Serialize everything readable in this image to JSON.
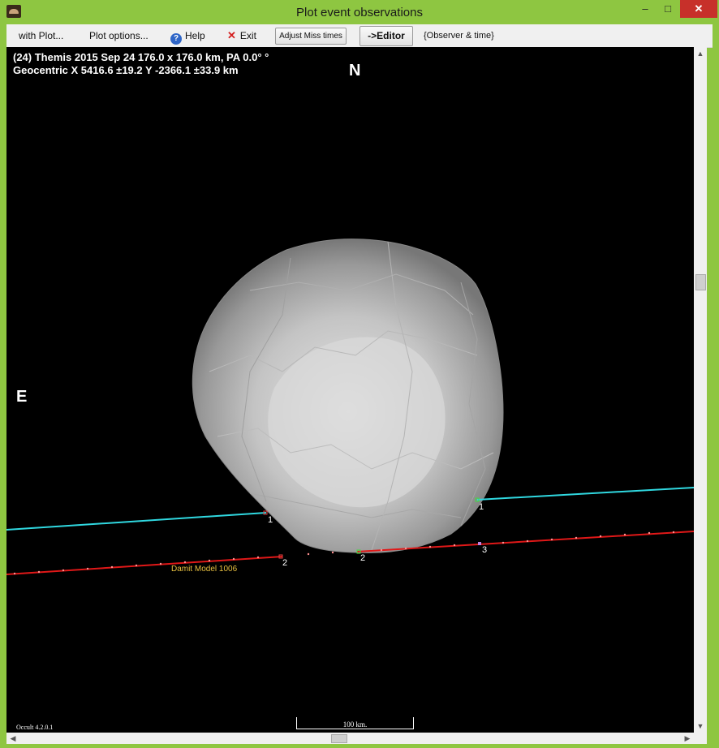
{
  "window": {
    "title": "Plot event observations",
    "minimize": "–",
    "maximize": "□",
    "close": "✕"
  },
  "menu": {
    "with_plot": "with Plot...",
    "plot_options": "Plot options...",
    "help": "Help",
    "exit": "Exit",
    "adjust_miss": "Adjust Miss times",
    "editor": "->Editor",
    "observer_time": "{Observer & time}"
  },
  "plot": {
    "info_line1": "(24) Themis  2015 Sep 24   176.0 x 176.0 km, PA 0.0° °",
    "info_line2": "Geocentric  X  5416.6 ±19.2  Y -2366.1 ±33.9 km",
    "north": "N",
    "east": "E",
    "version": "Occult 4.2.0.1",
    "scale_label": "100 km.",
    "model_label": "Damit Model 1006",
    "chord_labels": [
      "1",
      "2",
      "1",
      "2",
      "3"
    ]
  },
  "colors": {
    "background": "#000000",
    "cyan_chord": "#30d8e0",
    "red_chord": "#e01818",
    "asteroid": "#c0c0c0",
    "model_label": "#e8c040",
    "window_frame": "#8ec641"
  }
}
